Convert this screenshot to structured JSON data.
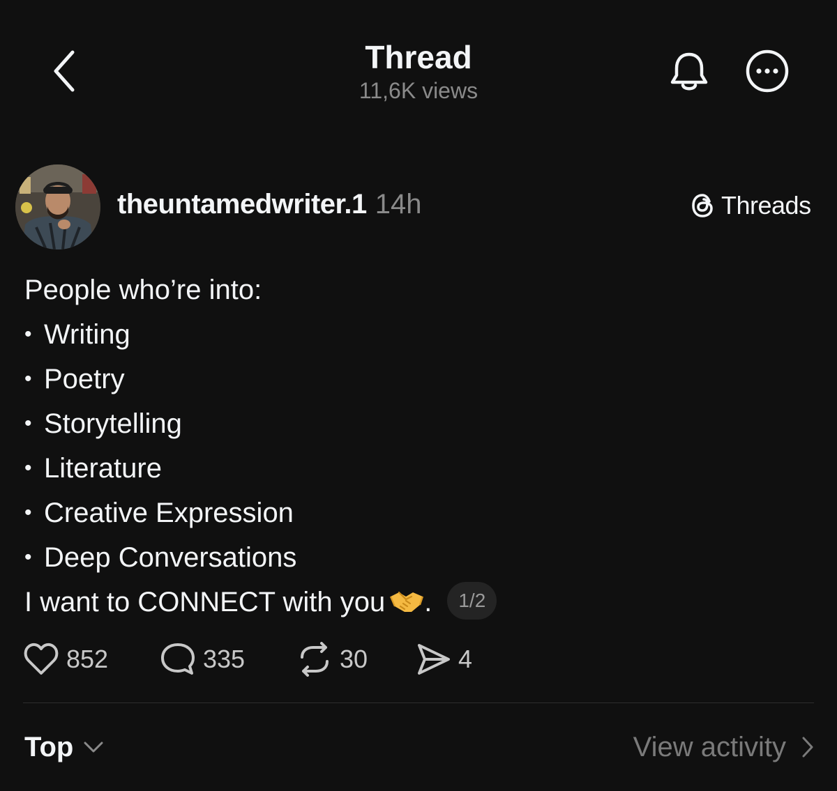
{
  "header": {
    "title": "Thread",
    "views": "11,6K views",
    "back_icon": "chevron-left-icon",
    "bell_icon": "bell-icon",
    "more_icon": "more-horizontal-icon"
  },
  "post": {
    "username": "theuntamedwriter.1",
    "time": "14h",
    "badge_label": "Threads",
    "badge_icon": "threads-logo-icon",
    "intro": "People who’re into:",
    "bullet": "•",
    "items": [
      "Writing",
      "Poetry",
      "Storytelling",
      "Literature",
      "Creative Expression",
      "Deep Conversations"
    ],
    "closing_text": "I want to CONNECT with you",
    "closing_emoji": "handshake-emoji",
    "closing_period": ".",
    "page_indicator": "1/2"
  },
  "actions": {
    "likes": "852",
    "replies": "335",
    "reposts": "30",
    "shares": "4"
  },
  "footer": {
    "sort_label": "Top",
    "activity_label": "View activity"
  },
  "colors": {
    "background": "#101010",
    "text_primary": "#f3f5f7",
    "text_secondary": "#8a8a8a",
    "divider": "#2e2e2e"
  }
}
